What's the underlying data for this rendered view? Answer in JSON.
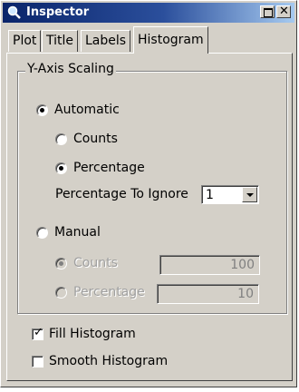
{
  "window": {
    "title": "Inspector",
    "icon": "magnifier-icon"
  },
  "tabs": [
    {
      "label": "Plot",
      "active": false
    },
    {
      "label": "Title",
      "active": false
    },
    {
      "label": "Labels",
      "active": false
    },
    {
      "label": "Histogram",
      "active": true
    }
  ],
  "y_axis_scaling": {
    "legend": "Y-Axis Scaling",
    "automatic": {
      "label": "Automatic",
      "selected": true
    },
    "auto_counts": {
      "label": "Counts",
      "selected": false
    },
    "auto_percentage": {
      "label": "Percentage",
      "selected": true
    },
    "percentage_to_ignore": {
      "label": "Percentage To Ignore",
      "value": "1"
    },
    "manual": {
      "label": "Manual",
      "selected": false
    },
    "manual_counts": {
      "label": "Counts",
      "value": "100",
      "selected": true,
      "enabled": false
    },
    "manual_percentage": {
      "label": "Percentage",
      "value": "10",
      "selected": false,
      "enabled": false
    }
  },
  "options": {
    "fill_histogram": {
      "label": "Fill Histogram",
      "checked": true
    },
    "smooth_histogram": {
      "label": "Smooth Histogram",
      "checked": false
    }
  }
}
